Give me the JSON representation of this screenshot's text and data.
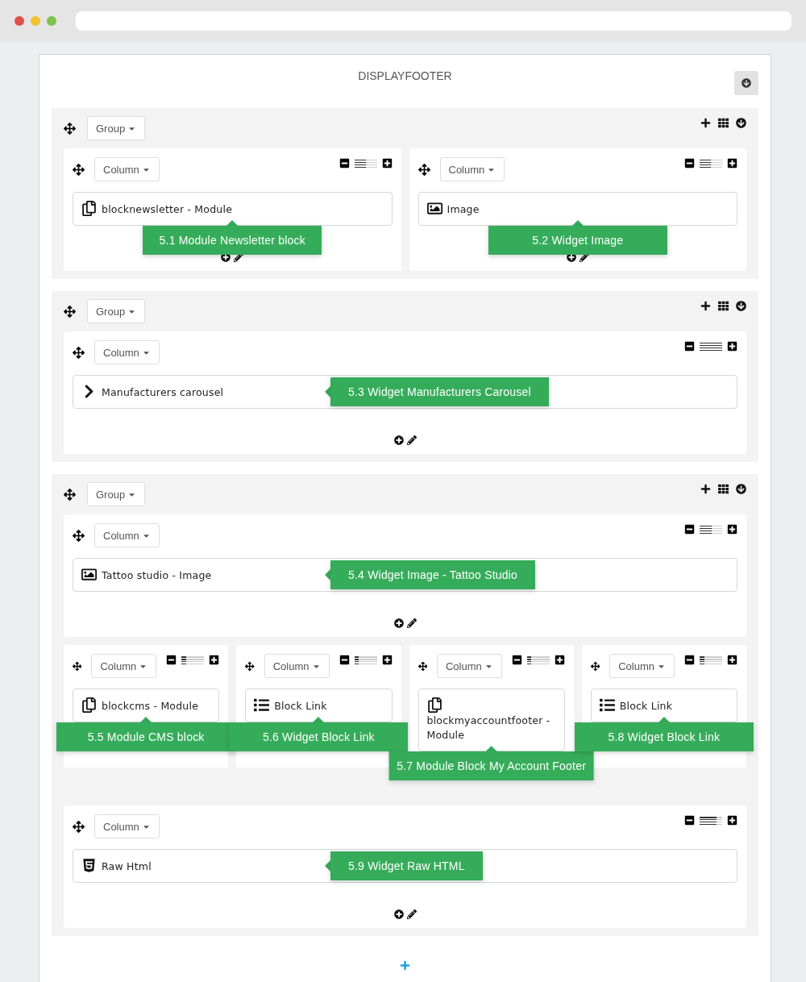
{
  "page_title": "DISPLAYFOOTER",
  "groups": [
    {
      "label": "Group",
      "rows": [
        [
          {
            "label": "Column",
            "level": 0.5,
            "footer": true,
            "element": {
              "kind": "module",
              "name": "blocknewsletter - Module"
            },
            "tooltip": {
              "text": "5.1 Module Newsletter block",
              "kind": "below"
            }
          },
          {
            "label": "Column",
            "level": 0.5,
            "footer": true,
            "element": {
              "kind": "image",
              "name": "Image"
            },
            "tooltip": {
              "text": "5.2 Widget Image",
              "kind": "below"
            }
          }
        ]
      ]
    },
    {
      "label": "Group",
      "rows": [
        [
          {
            "label": "Column",
            "level": 1,
            "footer": true,
            "element": {
              "kind": "chevron",
              "name": "Manufacturers carousel"
            },
            "tooltip": {
              "text": "5.3 Widget Manufacturers Carousel",
              "kind": "beside"
            }
          }
        ]
      ]
    },
    {
      "label": "Group",
      "rows": [
        [
          {
            "label": "Column",
            "level": 0.55,
            "footer": true,
            "element": {
              "kind": "image",
              "name": "Tattoo studio - Image"
            },
            "tooltip": {
              "text": "5.4 Widget Image - Tattoo Studio",
              "kind": "beside"
            }
          }
        ],
        [
          {
            "label": "Column",
            "level": 0.2,
            "footer": false,
            "element": {
              "kind": "module",
              "name": "blockcms - Module"
            },
            "tooltip": {
              "text": "5.5 Module CMS block",
              "kind": "below"
            }
          },
          {
            "label": "Column",
            "level": 0.2,
            "footer": false,
            "element": {
              "kind": "list",
              "name": "Block Link"
            },
            "tooltip": {
              "text": "5.6 Widget Block Link",
              "kind": "below"
            }
          },
          {
            "label": "Column",
            "level": 0.2,
            "footer": false,
            "element": {
              "kind": "module",
              "name": "blockmyaccountfooter - Module"
            },
            "tooltip": {
              "text": "5.7 Module Block My Account Footer",
              "kind": "below"
            }
          },
          {
            "label": "Column",
            "level": 0.2,
            "footer": false,
            "element": {
              "kind": "list",
              "name": "Block Link"
            },
            "tooltip": {
              "text": "5.8 Widget Block Link",
              "kind": "below"
            }
          }
        ],
        [
          {
            "label": "Column",
            "level": 0.75,
            "footer": true,
            "element": {
              "kind": "html5",
              "name": "Raw Html"
            },
            "tooltip": {
              "text": "5.9 Widget Raw HTML",
              "kind": "beside"
            }
          }
        ]
      ]
    }
  ]
}
